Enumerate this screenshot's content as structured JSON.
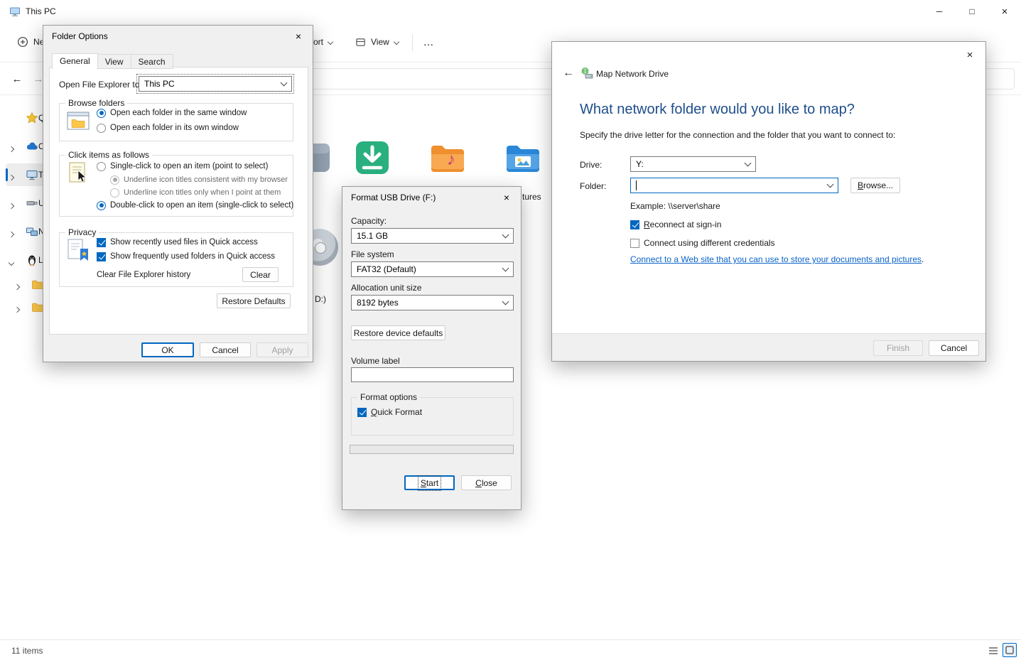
{
  "icons": {
    "back": "←",
    "forward": "→",
    "more": "…",
    "close": "×",
    "minimize": "─",
    "maximize": "□",
    "music_note": "♪"
  },
  "window": {
    "title": "This PC",
    "status_count": "11 items"
  },
  "toolbar": {
    "new": "New",
    "sort": "Sort",
    "view": "View"
  },
  "sidebar": {
    "items": [
      {
        "label": "Q"
      },
      {
        "label": "O"
      },
      {
        "label": "T"
      },
      {
        "label": "U"
      },
      {
        "label": "N"
      },
      {
        "label": "Li"
      }
    ]
  },
  "content": {
    "pictures_label_fragment": "tures",
    "dvd_label_fragment": "D:)"
  },
  "folder_options": {
    "title": "Folder Options",
    "tabs": {
      "general": "General",
      "view": "View",
      "search": "Search"
    },
    "open_to": {
      "label": "Open File Explorer to:",
      "value": "This PC"
    },
    "browse_folders": {
      "legend": "Browse folders",
      "same_window": "Open each folder in the same window",
      "own_window": "Open each folder in its own window"
    },
    "click_items": {
      "legend": "Click items as follows",
      "single_click": "Single-click to open an item (point to select)",
      "underline_consistent": "Underline icon titles consistent with my browser",
      "underline_point": "Underline icon titles only when I point at them",
      "double_click": "Double-click to open an item (single-click to select)"
    },
    "privacy": {
      "legend": "Privacy",
      "show_recent": "Show recently used files in Quick access",
      "show_frequent": "Show frequently used folders in Quick access",
      "clear_label": "Clear File Explorer history",
      "clear_button": "Clear"
    },
    "restore_defaults": "Restore Defaults",
    "ok": "OK",
    "cancel": "Cancel",
    "apply": "Apply"
  },
  "format_dialog": {
    "title": "Format USB Drive (F:)",
    "capacity": {
      "label": "Capacity:",
      "value": "15.1 GB"
    },
    "file_system": {
      "label": "File system",
      "value": "FAT32 (Default)"
    },
    "allocation": {
      "label": "Allocation unit size",
      "value": "8192 bytes"
    },
    "restore_defaults": "Restore device defaults",
    "volume": {
      "label": "Volume label",
      "value": ""
    },
    "format_options": {
      "legend": "Format options",
      "quick_format": "Quick Format"
    },
    "start": "Start",
    "close": "Close"
  },
  "map_network_drive": {
    "title": "Map Network Drive",
    "heading": "What network folder would you like to map?",
    "instruction": "Specify the drive letter for the connection and the folder that you want to connect to:",
    "drive": {
      "label": "Drive:",
      "value": "Y:"
    },
    "folder": {
      "label": "Folder:",
      "value": "",
      "browse": "Browse..."
    },
    "example": "Example: \\\\server\\share",
    "reconnect": "Reconnect at sign-in",
    "credentials": "Connect using different credentials",
    "web_link": "Connect to a Web site that you can use to store your documents and pictures",
    "web_link_suffix": ".",
    "finish": "Finish",
    "cancel": "Cancel"
  }
}
